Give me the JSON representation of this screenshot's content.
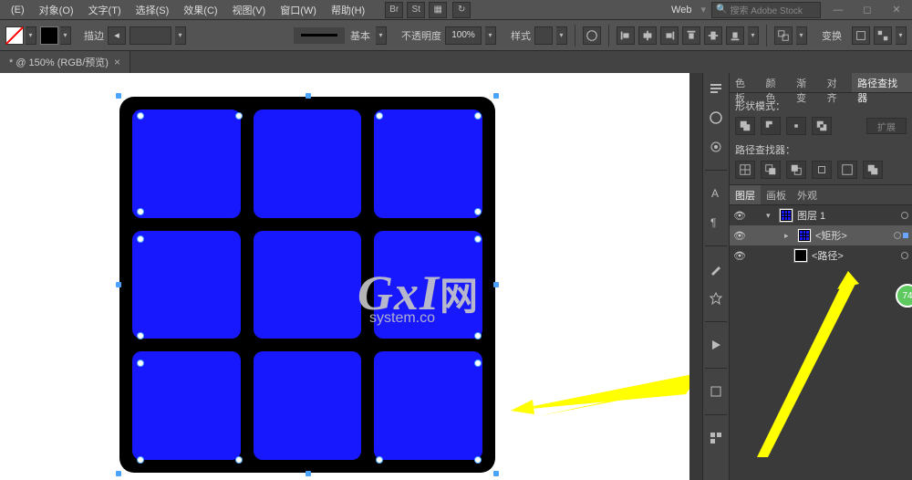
{
  "menu": {
    "items": [
      "(E)",
      "对象(O)",
      "文字(T)",
      "选择(S)",
      "效果(C)",
      "视图(V)",
      "窗口(W)",
      "帮助(H)"
    ],
    "brBtn": "Br",
    "stBtn": "St",
    "webLabel": "Web",
    "searchPlaceholder": "搜索 Adobe Stock"
  },
  "control": {
    "strokeLabel": "描边",
    "strokeBasic": "基本",
    "opacityLabel": "不透明度",
    "opacityValue": "100%",
    "styleLabel": "样式",
    "transformLabel": "变换"
  },
  "docTab": {
    "title": "* @ 150% (RGB/预览)"
  },
  "watermark": {
    "big": "GxI",
    "suffix": "网",
    "sub": "system.co"
  },
  "pathfinder": {
    "tabs": [
      "色板",
      "颜色",
      "渐变",
      "对齐",
      "路径查找器"
    ],
    "shapeModeLabel": "形状模式：",
    "expandLabel": "扩展",
    "pathfinderLabel": "路径查找器："
  },
  "layers": {
    "tabs": [
      "图层",
      "画板",
      "外观"
    ],
    "rows": [
      {
        "name": "图层 1",
        "indent": 0,
        "twisty": "▾",
        "thumb": "grid",
        "circle": true
      },
      {
        "name": "<矩形>",
        "indent": 1,
        "twisty": "▸",
        "thumb": "grid",
        "circle": true,
        "selected": true,
        "dot": true
      },
      {
        "name": "<路径>",
        "indent": 1,
        "twisty": "",
        "thumb": "rect",
        "circle": true
      }
    ],
    "badge": "74"
  }
}
